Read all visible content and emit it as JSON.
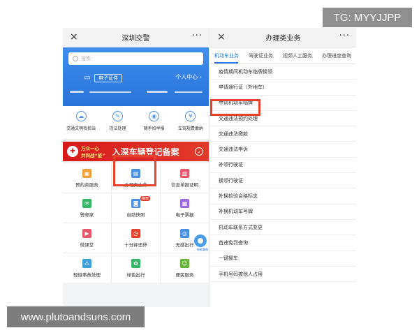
{
  "watermarks": {
    "top": "TG: MYYJJPP",
    "bottom": "www.plutoandsuns.com"
  },
  "left": {
    "titlebar": {
      "close": "×",
      "title": "深圳交警",
      "more": "···"
    },
    "search": {
      "placeholder": "搜索"
    },
    "header": {
      "eid_label": "电子证件",
      "personal_center": "个人中心 ›"
    },
    "icon_row": [
      {
        "label": "交通文明我担当",
        "glyph": "☁"
      },
      {
        "label": "违法处理",
        "glyph": "✎"
      },
      {
        "label": "随手拍举报",
        "glyph": "◉"
      },
      {
        "label": "车驾规费缴纳",
        "glyph": "¥"
      }
    ],
    "banner": {
      "line1": "万众一心",
      "line2": "共同战“疫”",
      "title": "入深车辆登记备案",
      "go": "›"
    },
    "grid": [
      {
        "label": "预约类服务",
        "glyph": "▣",
        "color": "#f0a23c"
      },
      {
        "label": "办理类业务",
        "glyph": "▤",
        "color": "#4a8fe2"
      },
      {
        "label": "信息单据证明",
        "glyph": "▥",
        "color": "#e8576a"
      },
      {
        "label": "警邮家",
        "glyph": "✉",
        "color": "#35b866"
      },
      {
        "label": "自助快照",
        "glyph": "◙",
        "color": "#4a8fe2",
        "badge": "推荐"
      },
      {
        "label": "电子票据",
        "glyph": "▦",
        "color": "#9a6ae0"
      },
      {
        "label": "微课堂",
        "glyph": "▶",
        "color": "#e8576a"
      },
      {
        "label": "十分钟违停",
        "glyph": "◷",
        "color": "#e8412e"
      },
      {
        "label": "无感出行",
        "glyph": "◎",
        "color": "#4a8fe2",
        "float_label": "智能客服"
      },
      {
        "label": "轻微事故处理",
        "glyph": "⚠",
        "color": "#3aa0d8"
      },
      {
        "label": "绿色出行",
        "glyph": "✿",
        "color": "#35b866"
      },
      {
        "label": "便民服务",
        "glyph": "☺",
        "color": "#66b23a"
      }
    ]
  },
  "right": {
    "titlebar": {
      "close": "×",
      "title": "办理类业务",
      "more": "···"
    },
    "tabs": [
      "机动车业务",
      "驾驶证业务",
      "视频人工服务",
      "办理进度查询"
    ],
    "items": [
      "疫情期间机动车临牌换领",
      "申请通行证（外地车）",
      "申请机动车临牌",
      "交通违法预约处理",
      "交通违法缴款",
      "交通违法申诉",
      "补领行驶证",
      "换领行驶证",
      "补换检验合格标志",
      "补换机动车号牌",
      "机动车联系方式变更",
      "首违免罚查询",
      "一键挪车",
      "手机号码被他人占用"
    ]
  }
}
